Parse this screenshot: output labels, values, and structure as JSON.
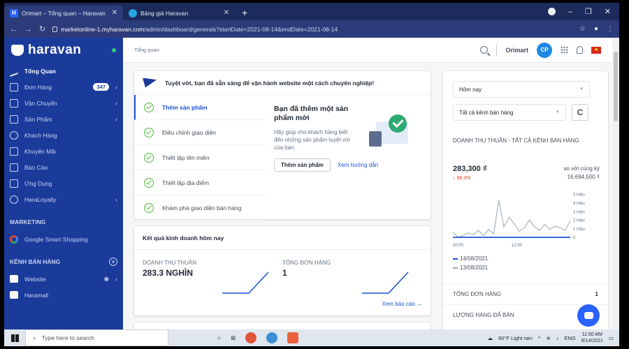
{
  "browser": {
    "tabs": [
      {
        "favicon": "H",
        "title": "Orimart – Tổng quan – Haravan"
      },
      {
        "favicon": "",
        "title": "Bảng giá Haravan"
      }
    ],
    "url_host": "marketonline-1.myharavan.com",
    "url_path": "/admin/dashboard/generals?startDate=2021-08-14&endDate=2021-08-14"
  },
  "sidebar": {
    "brand": "haravan",
    "items": [
      {
        "label": "Tổng Quan",
        "icon": "chart-line-icon"
      },
      {
        "label": "Đơn Hàng",
        "badge": "347",
        "icon": "cart-icon"
      },
      {
        "label": "Vận Chuyển",
        "icon": "truck-icon"
      },
      {
        "label": "Sản Phẩm",
        "icon": "tag-icon"
      },
      {
        "label": "Khách Hàng",
        "icon": "user-icon"
      },
      {
        "label": "Khuyến Mãi",
        "icon": "gift-icon"
      },
      {
        "label": "Báo Cáo",
        "icon": "report-icon"
      },
      {
        "label": "Ứng Dụng",
        "icon": "apps-icon"
      },
      {
        "label": "HaraLoyalty",
        "icon": "loyalty-icon"
      }
    ],
    "marketing_label": "MARKETING",
    "marketing_item": "Google Smart Shopping",
    "channels_label": "KÊNH BÁN HÀNG",
    "channel_item": "Website",
    "partial_item": "Haramall"
  },
  "topbar": {
    "breadcrumb": "Tổng quan",
    "shop_name": "Orimart",
    "avatar": "CP"
  },
  "onboarding": {
    "headline": "Tuyệt vời, bạn đã sẵn sàng để vận hành website một cách chuyên nghiệp!",
    "steps": [
      "Thêm sản phẩm",
      "Điều chỉnh giao diện",
      "Thiết lập tên miền",
      "Thiết lập địa điểm",
      "Khám phá giao diện bán hàng"
    ],
    "detail_title": "Bạn đã thêm một sản phẩm mới",
    "detail_text": "Hãy giúp cho khách hàng biết đến những sản phẩm tuyệt vời của bạn.",
    "primary_button": "Thêm sản phẩm",
    "secondary_link": "Xem hướng dẫn"
  },
  "results": {
    "title": "Kết quả kinh doanh hôm nay",
    "metrics": [
      {
        "label": "DOANH THU THUẦN",
        "value": "283.3 NGHÌN"
      },
      {
        "label": "TỔNG ĐƠN HÀNG",
        "value": "1"
      }
    ],
    "report_link": "Xem báo cáo →"
  },
  "right_panel": {
    "date_select": "Hôm nay",
    "channel_select": "Tất cả kênh bán hàng",
    "revenue_title": "DOANH THU THUẦN - TẤT CẢ KÊNH BÁN HÀNG",
    "revenue_value": "283,300 ₫",
    "revenue_change": "↓ 98.3%",
    "compare_label": "so với cùng kỳ",
    "compare_value": "16,694,500 ₫",
    "legend": [
      "14/08/2021",
      "13/08/2021"
    ],
    "rows": [
      {
        "label": "TỔNG ĐƠN HÀNG",
        "value": "1"
      },
      {
        "label": "LƯỢNG HÀNG ĐÃ BÁN",
        "value": ""
      }
    ]
  },
  "chart_data": {
    "type": "line",
    "x_ticks": [
      "00:00",
      "12:00"
    ],
    "y_ticks": [
      "0",
      "1 triệu",
      "2 triệu",
      "3 triệu",
      "4 triệu",
      "5 triệu"
    ],
    "ylim": [
      0,
      5000000
    ],
    "series": [
      {
        "name": "14/08/2021",
        "color": "#1a53d3",
        "values": [
          0,
          0,
          0,
          0,
          0,
          0,
          0,
          0,
          0,
          0,
          0,
          0,
          0,
          0,
          0,
          0,
          0,
          0,
          0,
          0,
          0,
          0,
          0,
          0
        ]
      },
      {
        "name": "13/08/2021",
        "color": "#9aa5b1",
        "values": [
          600000,
          0,
          200000,
          500000,
          300000,
          800000,
          200000,
          900000,
          400000,
          4300000,
          1200000,
          2300000,
          1600000,
          700000,
          1100000,
          2000000,
          1200000,
          800000,
          1500000,
          900000,
          1300000,
          1100000,
          800000,
          1900000
        ]
      }
    ]
  },
  "taskbar": {
    "search_placeholder": "Type here to search",
    "weather": "90°F  Light rain",
    "lang": "ENG",
    "time": "11:50 AM",
    "date": "8/14/2021"
  }
}
